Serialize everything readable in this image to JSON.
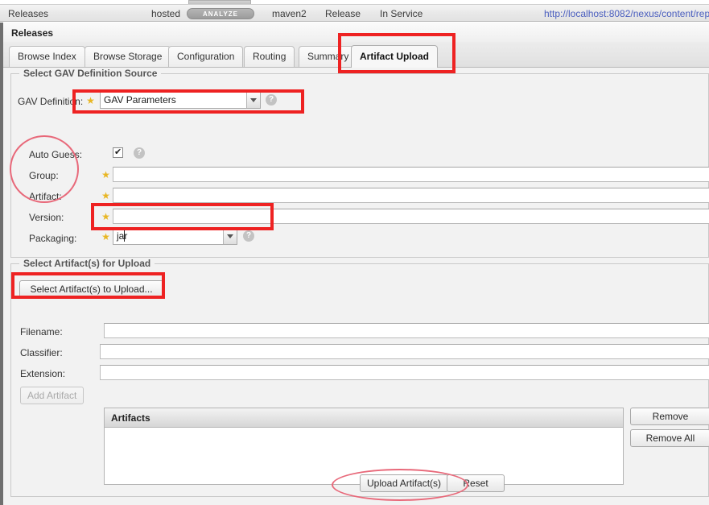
{
  "repo_strip": {
    "name": "Releases",
    "type": "hosted",
    "analyze_label": "ANALYZE",
    "format": "maven2",
    "policy": "Release",
    "status": "In Service",
    "url": "http://localhost:8082/nexus/content/rep"
  },
  "panel": {
    "title": "Releases"
  },
  "tabs": [
    {
      "label": "Browse Index",
      "active": false
    },
    {
      "label": "Browse Storage",
      "active": false
    },
    {
      "label": "Configuration",
      "active": false
    },
    {
      "label": "Routing",
      "active": false
    },
    {
      "label": "Summary",
      "active": false
    },
    {
      "label": "Artifact Upload",
      "active": true
    }
  ],
  "gav_section": {
    "legend": "Select GAV Definition Source",
    "gav_definition_label": "GAV Definition:",
    "gav_definition_value": "GAV Parameters",
    "auto_guess_label": "Auto Guess:",
    "auto_guess_checked": true,
    "group_label": "Group:",
    "group_value": "",
    "artifact_label": "Artifact:",
    "artifact_value": "",
    "version_label": "Version:",
    "version_value": "",
    "packaging_label": "Packaging:",
    "packaging_value": "jar",
    "required_star": "★",
    "help_glyph": "?"
  },
  "upload_section": {
    "legend": "Select Artifact(s) for Upload",
    "select_button": "Select Artifact(s) to Upload...",
    "filename_label": "Filename:",
    "filename_value": "",
    "classifier_label": "Classifier:",
    "classifier_value": "",
    "extension_label": "Extension:",
    "extension_value": "",
    "add_artifact_button": "Add Artifact",
    "add_artifact_disabled": true,
    "grid_header": "Artifacts",
    "grid_rows": [],
    "remove_button": "Remove",
    "remove_all_button": "Remove All",
    "upload_button": "Upload Artifact(s)",
    "reset_button": "Reset"
  },
  "colors": {
    "annotation_rect": "#ee2222",
    "annotation_ellipse": "#e8697a",
    "required_star": "#e8b623",
    "url_link": "#4b5fbf",
    "panel_bg": "#f2f2f2"
  }
}
